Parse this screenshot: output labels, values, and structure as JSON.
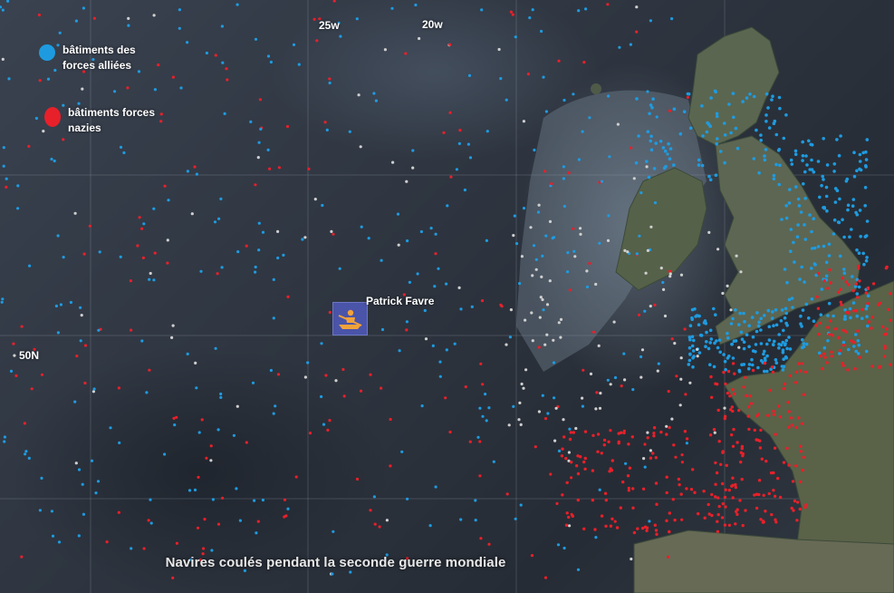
{
  "title": "Navires coulés pendant la seconde guerre mondiale",
  "legend": [
    {
      "label": "bâtiments des forces alliées",
      "color": "#1e9be0"
    },
    {
      "label": "bâtiments forces nazies",
      "color": "#e8202a"
    }
  ],
  "markers": [
    {
      "label": "Patrick Favre",
      "icon": "rowing-boat-icon",
      "color": "#4a54a8"
    }
  ],
  "graticule_labels": {
    "lon_25w": "25w",
    "lon_20w": "20w",
    "lat_50n": "50N"
  },
  "colors": {
    "allied": "#1e9be0",
    "nazi": "#e8202a",
    "neutral": "#cfcfcf",
    "land": "#5a6350",
    "ocean": "#2f3641"
  }
}
